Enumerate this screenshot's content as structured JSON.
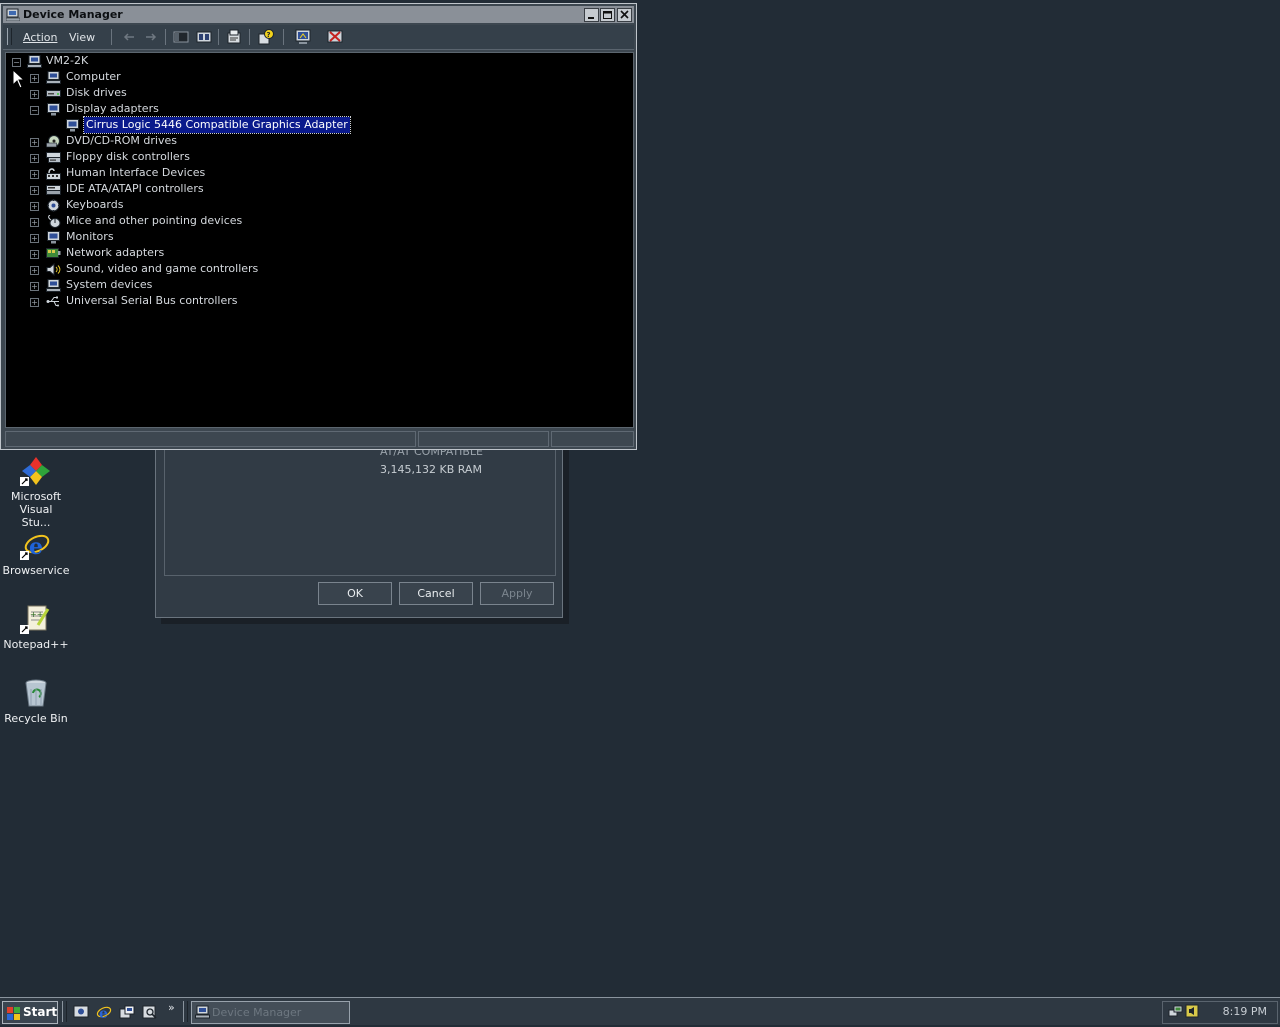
{
  "window": {
    "title": "Device Manager",
    "menu": [
      "Action",
      "View"
    ]
  },
  "tree": {
    "root": "VM2-2K",
    "items": [
      {
        "label": "Computer",
        "icon": "computer-icon",
        "expanded": false
      },
      {
        "label": "Disk drives",
        "icon": "disk-drive-icon",
        "expanded": false
      },
      {
        "label": "Display adapters",
        "icon": "monitor-icon",
        "expanded": true
      },
      {
        "label": "Cirrus Logic 5446 Compatible Graphics Adapter",
        "icon": "display-adapter-icon",
        "child": true,
        "selected": true
      },
      {
        "label": "DVD/CD-ROM drives",
        "icon": "cdrom-icon",
        "expanded": false
      },
      {
        "label": "Floppy disk controllers",
        "icon": "floppy-controller-icon",
        "expanded": false
      },
      {
        "label": "Human Interface Devices",
        "icon": "hid-icon",
        "expanded": false
      },
      {
        "label": "IDE ATA/ATAPI controllers",
        "icon": "ide-controller-icon",
        "expanded": false
      },
      {
        "label": "Keyboards",
        "icon": "keyboard-icon",
        "expanded": false
      },
      {
        "label": "Mice and other pointing devices",
        "icon": "mouse-icon",
        "expanded": false
      },
      {
        "label": "Monitors",
        "icon": "monitor-icon",
        "expanded": false
      },
      {
        "label": "Network adapters",
        "icon": "network-adapter-icon",
        "expanded": false
      },
      {
        "label": "Sound, video and game controllers",
        "icon": "sound-icon",
        "expanded": false
      },
      {
        "label": "System devices",
        "icon": "system-devices-icon",
        "expanded": false
      },
      {
        "label": "Universal Serial Bus controllers",
        "icon": "usb-icon",
        "expanded": false
      }
    ]
  },
  "system_properties": {
    "line1": "AT/AT COMPATIBLE",
    "line2": "3,145,132 KB RAM",
    "ok": "OK",
    "cancel": "Cancel",
    "apply": "Apply"
  },
  "desktop": {
    "icons": [
      {
        "label": "Microsoft Visual Stu...",
        "icon": "visual-studio-icon"
      },
      {
        "label": "Browservice",
        "icon": "internet-explorer-icon"
      },
      {
        "label": "Notepad++",
        "icon": "notepad-plus-plus-icon"
      },
      {
        "label": "Recycle Bin",
        "icon": "recycle-bin-icon"
      }
    ]
  },
  "taskbar": {
    "start": "Start",
    "active_task": "Device Manager",
    "clock": "8:19 PM",
    "more": "»"
  },
  "colors": {
    "desktop": "#222c36",
    "selection": "#0a1a8c",
    "tree_background": "#000000"
  }
}
